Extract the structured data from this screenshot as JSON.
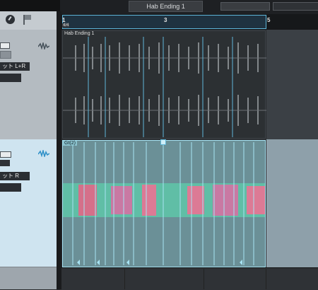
{
  "top": {
    "clip_name_field": "Hab Ending 1"
  },
  "ruler": {
    "marks": [
      "1",
      "3",
      "5"
    ],
    "loop_tag": "4/4"
  },
  "tracks": [
    {
      "clip_label": "Hab Ending 1",
      "output": "ット L+R"
    },
    {
      "clip_label": "Gt(2)",
      "output": "ット R"
    }
  ],
  "icons": [
    "metronome-icon",
    "flag-icon",
    "waveform-icon"
  ],
  "colors": {
    "accent": "#5fb6d9",
    "selected_track_bg": "#cfe4f0",
    "clip2_bg": "#6b9097"
  }
}
